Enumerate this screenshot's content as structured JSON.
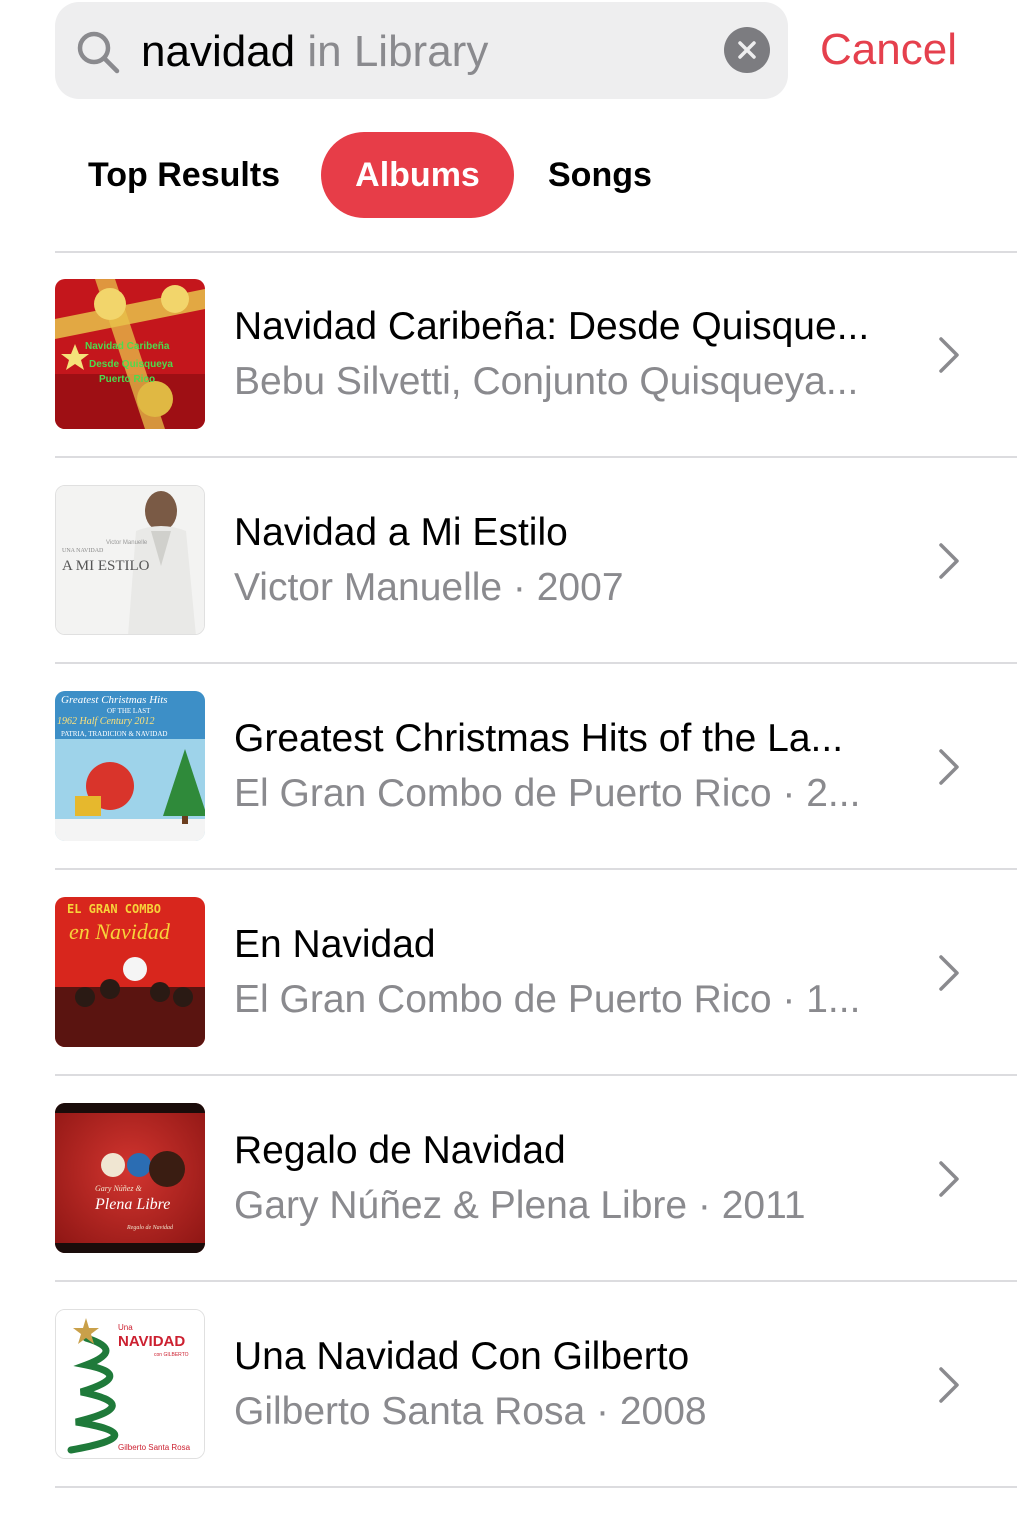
{
  "search": {
    "query": "navidad",
    "scope": " in Library",
    "cancel_label": "Cancel"
  },
  "tabs": [
    {
      "label": "Top Results",
      "selected": false
    },
    {
      "label": "Albums",
      "selected": true
    },
    {
      "label": "Songs",
      "selected": false
    }
  ],
  "albums": [
    {
      "title": "Navidad Caribeña: Desde Quisque...",
      "subtitle": "Bebu Silvetti, Conjunto Quisqueya...",
      "art_text": [
        "Navidad Caribeña",
        "Desde Quisqueya",
        "Puerto Rico"
      ]
    },
    {
      "title": "Navidad a Mi Estilo",
      "subtitle": "Victor Manuelle · 2007",
      "art_text": [
        "Victor Manuelle",
        "UNA NAVIDAD",
        "A MI ESTILO"
      ]
    },
    {
      "title": "Greatest Christmas Hits of the La...",
      "subtitle": "El Gran Combo de Puerto Rico · 2...",
      "art_text": [
        "Greatest Christmas Hits",
        "OF THE LAST",
        "1962 Half Century 2012",
        "PATRIA, TRADICION & NAVIDAD"
      ]
    },
    {
      "title": "En Navidad",
      "subtitle": "El Gran Combo de Puerto Rico · 1...",
      "art_text": [
        "EL GRAN COMBO",
        "en Navidad"
      ]
    },
    {
      "title": "Regalo de Navidad",
      "subtitle": "Gary Núñez & Plena Libre · 2011",
      "art_text": [
        "Gary Núñez &",
        "Plena Libre",
        "Regalo de Navidad"
      ]
    },
    {
      "title": "Una Navidad Con Gilberto",
      "subtitle": "Gilberto Santa Rosa · 2008",
      "art_text": [
        "Una",
        "NAVIDAD",
        "con GILBERTO",
        "Gilberto Santa Rosa"
      ]
    }
  ],
  "colors": {
    "accent": "#e73d48",
    "cancel": "#e5404d",
    "secondary_text": "#8a8a8e",
    "search_field": "#eeeeef"
  }
}
